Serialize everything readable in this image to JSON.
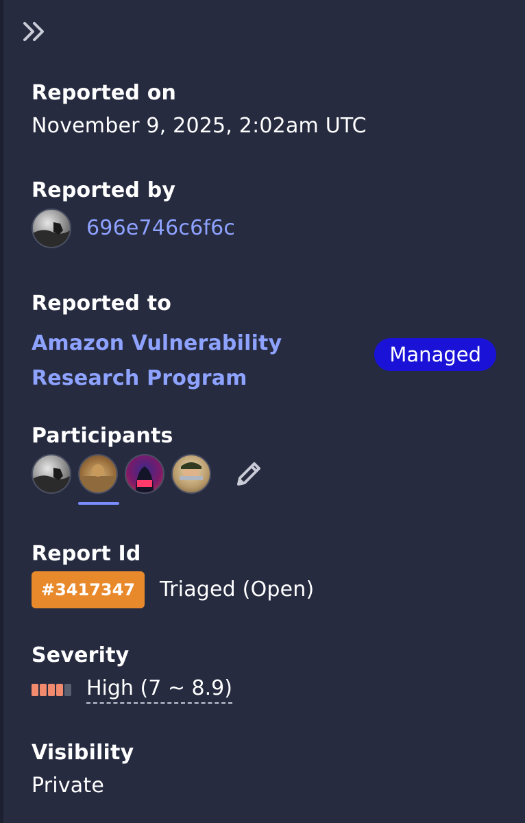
{
  "panel": {
    "collapse_icon": "double-chevron-right-icon"
  },
  "reported_on": {
    "label": "Reported on",
    "value": "November 9, 2025, 2:02am UTC"
  },
  "reported_by": {
    "label": "Reported by",
    "username": "696e746c6f6c"
  },
  "reported_to": {
    "label": "Reported to",
    "program_line1": "Amazon Vulnerability",
    "program_line2": "Research Program",
    "badge": "Managed"
  },
  "participants": {
    "label": "Participants",
    "count": 4,
    "edit_icon": "pencil-icon"
  },
  "report_id": {
    "label": "Report Id",
    "id": "#3417347",
    "status": "Triaged (Open)"
  },
  "severity": {
    "label": "Severity",
    "text": "High (7 ~ 8.9)",
    "level_filled": 4,
    "level_total": 5
  },
  "visibility": {
    "label": "Visibility",
    "value": "Private"
  },
  "colors": {
    "background": "#262b40",
    "link": "#8ea2ff",
    "managed_badge": "#1a12d6",
    "report_id_badge": "#e8892c",
    "severity_fill": "#f28a6e",
    "severity_empty": "#5a5f70"
  }
}
